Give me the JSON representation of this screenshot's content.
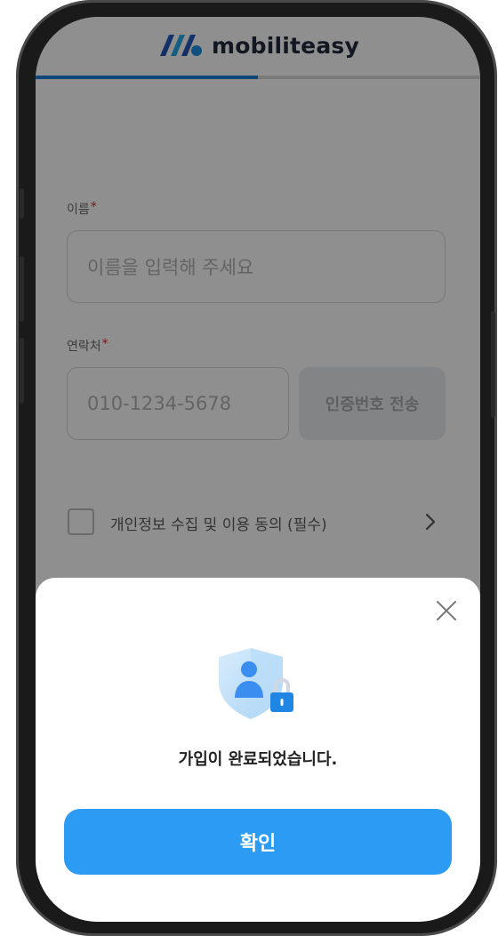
{
  "app": {
    "brand_name": "mobiliteasy",
    "signup_progress_percent": 50
  },
  "form": {
    "name": {
      "label": "이름",
      "required_mark": "*",
      "placeholder": "이름을 입력해 주세요"
    },
    "phone": {
      "label": "연락처",
      "required_mark": "*",
      "placeholder": "010-1234-5678",
      "send_code_label": "인증번호 전송"
    },
    "consent": {
      "label": "개인정보 수집 및 이용 동의 (필수)",
      "checked": false
    }
  },
  "modal": {
    "message": "가입이 완료되었습니다.",
    "confirm_label": "확인"
  },
  "colors": {
    "accent": "#2b9bf4",
    "progress": "#1f7fd6",
    "required": "#e02a2a"
  },
  "icons": {
    "logo": "mobiliteasy-logo-icon",
    "consent_arrow": "chevron-right-icon",
    "close": "close-icon",
    "success": "shield-user-lock-icon"
  }
}
